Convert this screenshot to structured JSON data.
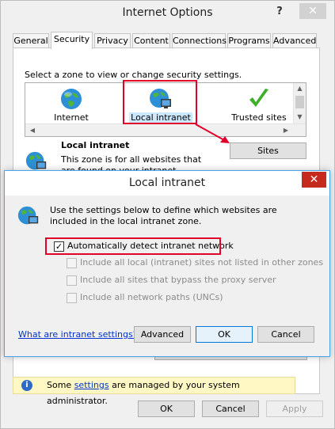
{
  "window": {
    "title": "Internet Options",
    "help_glyph": "?",
    "close_glyph": "✕"
  },
  "tabs": [
    {
      "label": "General"
    },
    {
      "label": "Security",
      "active": true
    },
    {
      "label": "Privacy"
    },
    {
      "label": "Content"
    },
    {
      "label": "Connections"
    },
    {
      "label": "Programs"
    },
    {
      "label": "Advanced"
    }
  ],
  "security": {
    "zone_prompt": "Select a zone to view or change security settings.",
    "zones": [
      {
        "label": "Internet",
        "icon": "globe-icon"
      },
      {
        "label": "Local intranet",
        "icon": "intranet-icon",
        "selected": true
      },
      {
        "label": "Trusted sites",
        "icon": "check-icon"
      }
    ],
    "selected_zone_title": "Local intranet",
    "selected_zone_desc": "This zone is for all websites that are found on your intranet.",
    "sites_button": "Sites"
  },
  "notice": {
    "prefix": "Some ",
    "link": "settings",
    "suffix": " are managed by your system administrator."
  },
  "footer": {
    "ok": "OK",
    "cancel": "Cancel",
    "apply": "Apply"
  },
  "dialog": {
    "title": "Local intranet",
    "close_glyph": "✕",
    "description": "Use the settings below to define which websites are included in the local intranet zone.",
    "checkboxes": [
      {
        "label": "Automatically detect intranet network",
        "checked": true,
        "enabled": true
      },
      {
        "label": "Include all local (intranet) sites not listed in other zones",
        "checked": false,
        "enabled": false
      },
      {
        "label": "Include all sites that bypass the proxy server",
        "checked": false,
        "enabled": false
      },
      {
        "label": "Include all network paths (UNCs)",
        "checked": false,
        "enabled": false
      }
    ],
    "link": "What are intranet settings?",
    "advanced": "Advanced",
    "ok": "OK",
    "cancel": "Cancel"
  },
  "colors": {
    "highlight": "#e0002a",
    "link": "#0033cc",
    "dialog_border": "#46a4e8"
  }
}
